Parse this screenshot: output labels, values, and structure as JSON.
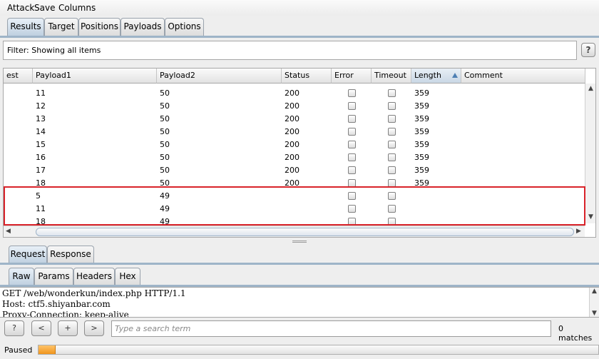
{
  "menu": [
    "Attack",
    "Save",
    "Columns"
  ],
  "main_tabs": [
    "Results",
    "Target",
    "Positions",
    "Payloads",
    "Options"
  ],
  "filter": {
    "text": "Filter: Showing all items",
    "help": "?"
  },
  "table": {
    "columns": [
      "est",
      "Payload1",
      "Payload2",
      "Status",
      "Error",
      "Timeout",
      "Length",
      "Comment"
    ],
    "sorted_column": "Length",
    "rows": [
      {
        "payload1": "11",
        "payload2": "50",
        "status": "200",
        "length": "359"
      },
      {
        "payload1": "12",
        "payload2": "50",
        "status": "200",
        "length": "359"
      },
      {
        "payload1": "13",
        "payload2": "50",
        "status": "200",
        "length": "359"
      },
      {
        "payload1": "14",
        "payload2": "50",
        "status": "200",
        "length": "359"
      },
      {
        "payload1": "15",
        "payload2": "50",
        "status": "200",
        "length": "359"
      },
      {
        "payload1": "16",
        "payload2": "50",
        "status": "200",
        "length": "359"
      },
      {
        "payload1": "17",
        "payload2": "50",
        "status": "200",
        "length": "359"
      },
      {
        "payload1": "18",
        "payload2": "50",
        "status": "200",
        "length": "359"
      },
      {
        "payload1": "5",
        "payload2": "49",
        "status": "",
        "length": ""
      },
      {
        "payload1": "11",
        "payload2": "49",
        "status": "",
        "length": ""
      },
      {
        "payload1": "18",
        "payload2": "49",
        "status": "",
        "length": ""
      }
    ]
  },
  "lower_tabs": [
    "Request",
    "Response"
  ],
  "view_tabs": [
    "Raw",
    "Params",
    "Headers",
    "Hex"
  ],
  "request_lines": [
    "GET /web/wonderkun/index.php HTTP/1.1",
    "Host: ctf5.shiyanbar.com",
    "Proxy-Connection: keep-alive"
  ],
  "search": {
    "buttons": [
      "?",
      "<",
      "+",
      ">"
    ],
    "placeholder": "Type a search term",
    "matches": "0 matches"
  },
  "status": {
    "label": "Paused",
    "progress": 0.03
  },
  "colors": {
    "highlight": "#d9232a",
    "progress": "#f0951c",
    "tab_accent": "#9eb4c8"
  }
}
